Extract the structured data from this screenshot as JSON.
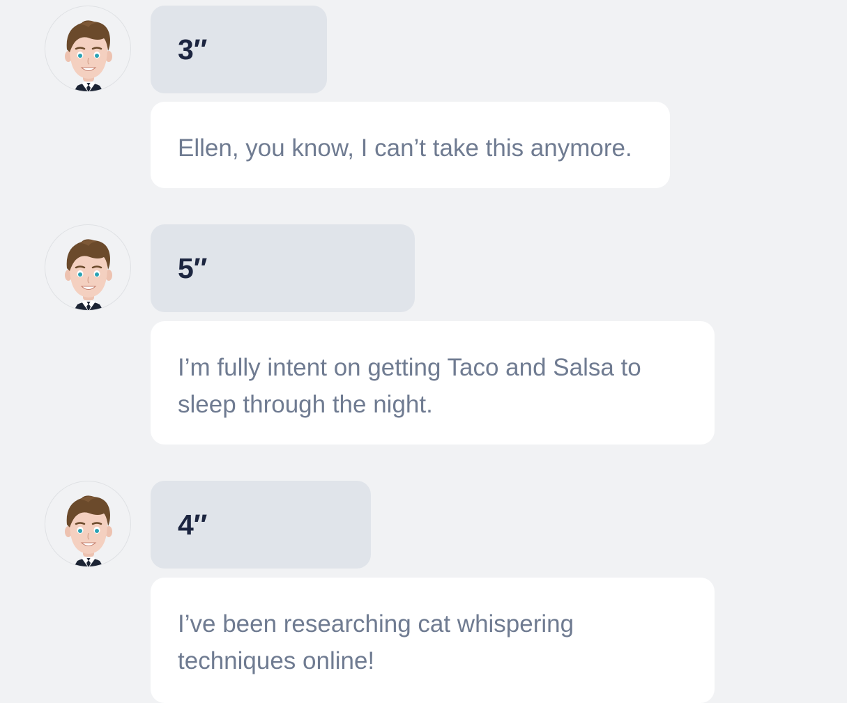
{
  "messages": [
    {
      "avatar_icon": "boy-avatar-icon",
      "duration": "3″",
      "text": "Ellen, you know, I can’t take this anymore."
    },
    {
      "avatar_icon": "boy-avatar-icon",
      "duration": "5″",
      "text": "I’m fully intent on getting Taco and Salsa to sleep through the night."
    },
    {
      "avatar_icon": "boy-avatar-icon",
      "duration": "4″",
      "text": "I’ve been researching cat whispering techniques online!"
    }
  ],
  "colors": {
    "background": "#f1f2f4",
    "duration_bubble": "#e0e4ea",
    "text_bubble": "#ffffff",
    "duration_text": "#1c2540",
    "message_text": "#6f7b91"
  }
}
